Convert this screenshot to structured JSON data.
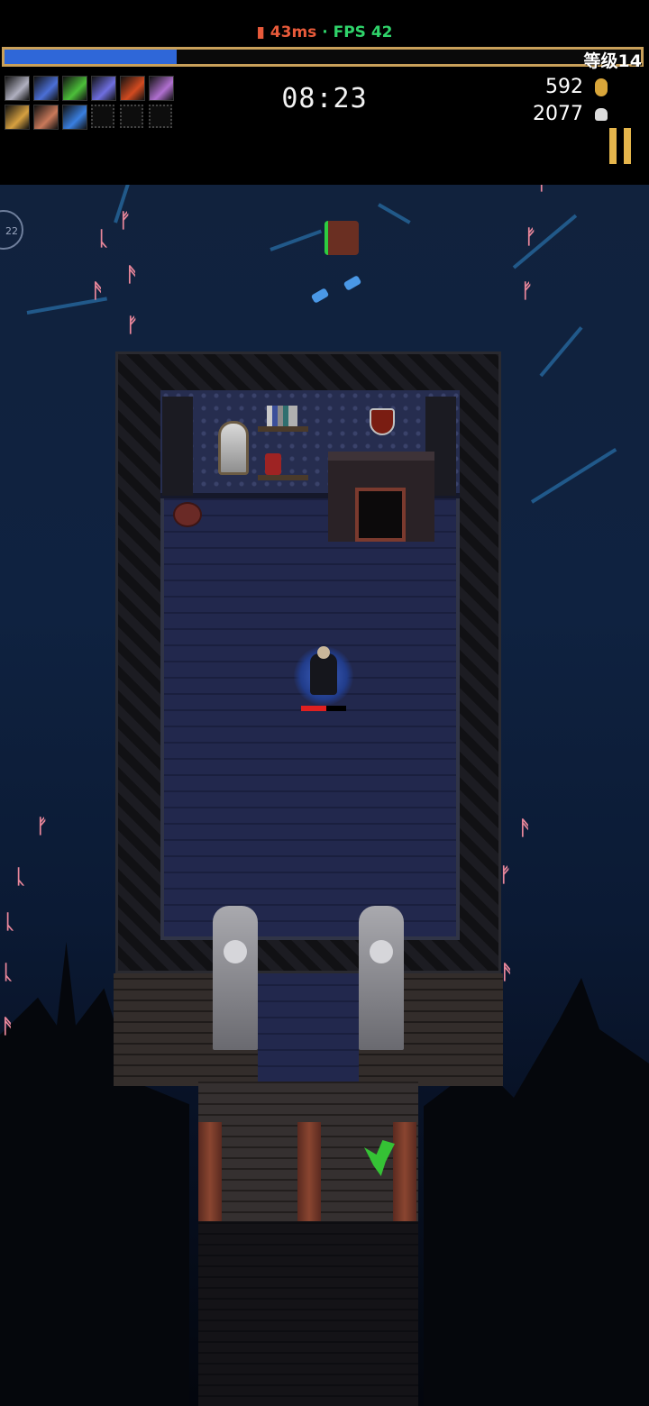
{
  "hud": {
    "ping": "43ms",
    "separator": "·",
    "fps": "FPS 42",
    "level_label": "等级14",
    "xp_progress": 0.27,
    "timer": "08:23",
    "gold": "592",
    "kills": "2077",
    "gold_icon": "coin-icon",
    "kills_icon": "skull-icon",
    "pause_icon": "pause-icon"
  },
  "weapons": [
    {
      "icon": "whip-icon",
      "color": "#b0b0c0"
    },
    {
      "icon": "wings-icon",
      "color": "#4b6fd6"
    },
    {
      "icon": "garlic-icon",
      "color": "#4cbf3a"
    },
    {
      "icon": "runetracer-icon",
      "color": "#6f6fe0"
    },
    {
      "icon": "fire-wand-icon",
      "color": "#d24b20"
    },
    {
      "icon": "pentagram-icon",
      "color": "#b070d0"
    }
  ],
  "passives": [
    {
      "icon": "candelabrador-icon",
      "color": "#d6a040"
    },
    {
      "icon": "armor-icon",
      "color": "#c9795a"
    },
    {
      "icon": "ring-icon",
      "color": "#3a7fe0"
    },
    {
      "icon": "empty-slot-icon",
      "color": ""
    },
    {
      "icon": "empty-slot-icon",
      "color": ""
    },
    {
      "icon": "empty-slot-icon",
      "color": ""
    }
  ],
  "minimap": {
    "label": "22"
  },
  "player": {
    "hp_fraction": 0.55
  }
}
